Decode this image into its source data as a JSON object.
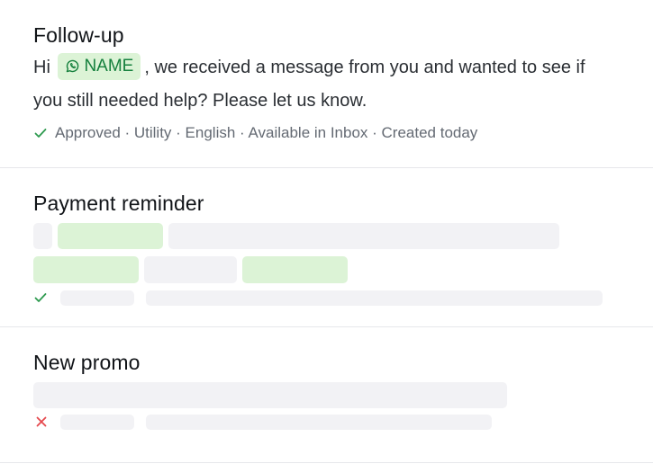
{
  "templates": [
    {
      "title": "Follow-up",
      "body_prefix": "Hi",
      "variable_label": "NAME",
      "variable_icon": "whatsapp-icon",
      "body_suffix": ", we received a message from you and wanted to see if you still needed help? Please let us know.",
      "status": "approved",
      "meta": "Approved · Utility · English · Available in Inbox · Created today"
    },
    {
      "title": "Payment reminder",
      "status": "approved",
      "loading": true
    },
    {
      "title": "New promo",
      "status": "rejected",
      "loading": true
    }
  ],
  "colors": {
    "approved": "#2e9a4f",
    "rejected": "#e5484d",
    "variable_bg": "#dcf3d6",
    "variable_text": "#15803d",
    "skeleton": "#f2f2f5"
  }
}
